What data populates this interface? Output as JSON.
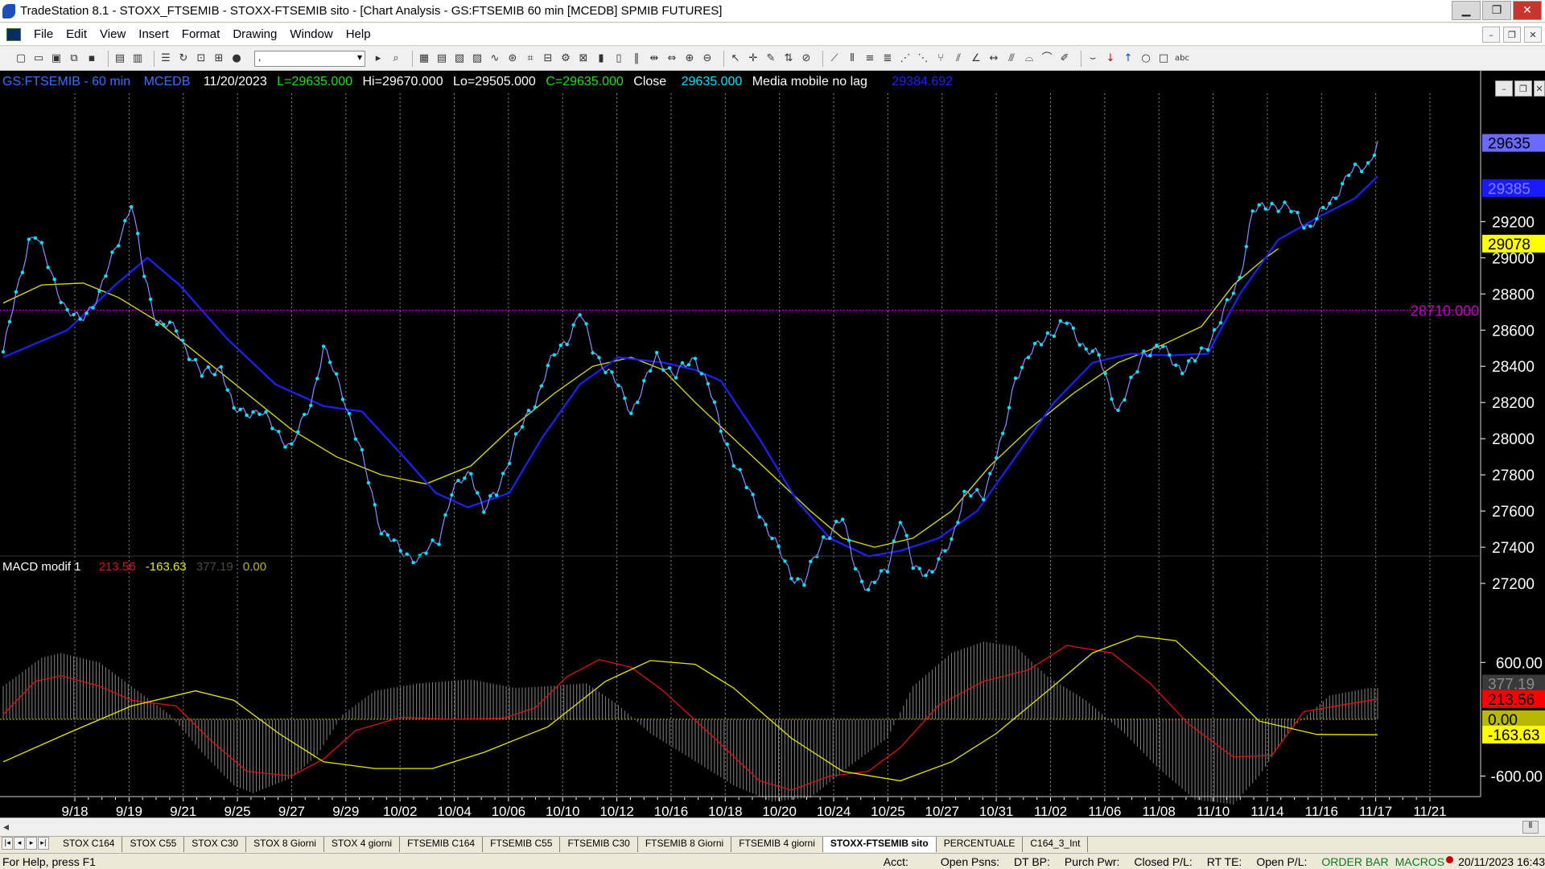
{
  "window": {
    "title": "TradeStation 8.1 - STOXX_FTSEMIB - STOXX-FTSEMIB sito - [Chart Analysis - GS:FTSEMIB  60 min  [MCEDB] SPMIB FUTURES]",
    "min_label": "▁",
    "max_label": "❐",
    "close_label": "✕"
  },
  "menu": {
    "items": [
      "File",
      "Edit",
      "View",
      "Insert",
      "Format",
      "Drawing",
      "Window",
      "Help"
    ],
    "mdi_min": "–",
    "mdi_restore": "❐",
    "mdi_close": "✕"
  },
  "toolbar": {
    "combo_value": ","
  },
  "header": {
    "symbol": "GS:FTSEMIB - 60 min",
    "exchange": "MCEDB",
    "date": "11/20/2023",
    "last": "L=29635.000",
    "high": "Hi=29670.000",
    "low": "Lo=29505.000",
    "close": "C=29635.000",
    "close_label": "Close",
    "close_value": "29635.000",
    "ma_label": "Media mobile no lag",
    "ma_value": "29384.692"
  },
  "macd_header": {
    "name": "MACD modif 1",
    "v1": "213.56",
    "v2": "-163.63",
    "v3": "377.19",
    "v4": "0.00"
  },
  "colors": {
    "price": "#00e5ff",
    "ma_blue": "#2020ff",
    "ma_yellow": "#e0e000",
    "macd_red": "#e01010",
    "macd_yellow": "#e8e800",
    "hist": "#7a7a7a",
    "hline": "#c000c0",
    "grid": "#8a8a8a"
  },
  "chart_data": [
    {
      "type": "line",
      "name": "price",
      "ylim": [
        27000,
        29900
      ],
      "yticks": [
        27200,
        27400,
        27600,
        27800,
        28000,
        28200,
        28400,
        28600,
        28800,
        29000,
        29200
      ],
      "xticks": [
        "9/18",
        "9/19",
        "9/21",
        "9/25",
        "9/27",
        "9/29",
        "10/02",
        "10/04",
        "10/06",
        "10/10",
        "10/12",
        "10/16",
        "10/18",
        "10/20",
        "10/24",
        "10/25",
        "10/27",
        "10/31",
        "11/02",
        "11/06",
        "11/08",
        "11/10",
        "11/14",
        "11/16",
        "11/17",
        "11/21"
      ],
      "bars_total": 430,
      "close": [
        [
          0,
          28480
        ],
        [
          8,
          29100
        ],
        [
          10,
          29130
        ],
        [
          20,
          28700
        ],
        [
          24,
          28650
        ],
        [
          30,
          28800
        ],
        [
          40,
          29300
        ],
        [
          44,
          28900
        ],
        [
          48,
          28650
        ],
        [
          54,
          28600
        ],
        [
          62,
          28350
        ],
        [
          68,
          28400
        ],
        [
          72,
          28150
        ],
        [
          80,
          28150
        ],
        [
          90,
          27950
        ],
        [
          96,
          28200
        ],
        [
          100,
          28500
        ],
        [
          106,
          28250
        ],
        [
          112,
          27900
        ],
        [
          118,
          27500
        ],
        [
          124,
          27380
        ],
        [
          130,
          27330
        ],
        [
          136,
          27450
        ],
        [
          140,
          27700
        ],
        [
          146,
          27820
        ],
        [
          150,
          27600
        ],
        [
          154,
          27700
        ],
        [
          160,
          28000
        ],
        [
          166,
          28200
        ],
        [
          170,
          28400
        ],
        [
          176,
          28550
        ],
        [
          180,
          28700
        ],
        [
          184,
          28490
        ],
        [
          190,
          28350
        ],
        [
          196,
          28150
        ],
        [
          204,
          28450
        ],
        [
          210,
          28350
        ],
        [
          216,
          28450
        ],
        [
          220,
          28300
        ],
        [
          224,
          28050
        ],
        [
          230,
          27800
        ],
        [
          236,
          27600
        ],
        [
          240,
          27450
        ],
        [
          246,
          27250
        ],
        [
          250,
          27200
        ],
        [
          256,
          27450
        ],
        [
          262,
          27550
        ],
        [
          266,
          27300
        ],
        [
          270,
          27150
        ],
        [
          276,
          27300
        ],
        [
          280,
          27550
        ],
        [
          284,
          27300
        ],
        [
          290,
          27250
        ],
        [
          296,
          27450
        ],
        [
          300,
          27680
        ],
        [
          306,
          27700
        ],
        [
          312,
          28000
        ],
        [
          316,
          28350
        ],
        [
          320,
          28450
        ],
        [
          326,
          28580
        ],
        [
          332,
          28640
        ],
        [
          338,
          28500
        ],
        [
          342,
          28450
        ],
        [
          348,
          28150
        ],
        [
          352,
          28300
        ],
        [
          356,
          28480
        ],
        [
          362,
          28500
        ],
        [
          368,
          28380
        ],
        [
          372,
          28430
        ],
        [
          376,
          28530
        ],
        [
          380,
          28650
        ],
        [
          386,
          28900
        ],
        [
          390,
          29250
        ],
        [
          396,
          29300
        ],
        [
          402,
          29260
        ],
        [
          408,
          29170
        ],
        [
          414,
          29300
        ],
        [
          420,
          29460
        ],
        [
          426,
          29520
        ],
        [
          429,
          29635
        ]
      ],
      "blue_ma": [
        [
          0,
          28450
        ],
        [
          20,
          28600
        ],
        [
          35,
          28850
        ],
        [
          45,
          29000
        ],
        [
          55,
          28850
        ],
        [
          70,
          28550
        ],
        [
          85,
          28300
        ],
        [
          100,
          28180
        ],
        [
          112,
          28150
        ],
        [
          125,
          27900
        ],
        [
          135,
          27700
        ],
        [
          145,
          27620
        ],
        [
          158,
          27700
        ],
        [
          168,
          28000
        ],
        [
          180,
          28300
        ],
        [
          192,
          28450
        ],
        [
          206,
          28420
        ],
        [
          216,
          28380
        ],
        [
          224,
          28320
        ],
        [
          236,
          28000
        ],
        [
          248,
          27650
        ],
        [
          258,
          27450
        ],
        [
          270,
          27350
        ],
        [
          280,
          27380
        ],
        [
          292,
          27450
        ],
        [
          304,
          27600
        ],
        [
          316,
          27900
        ],
        [
          328,
          28200
        ],
        [
          340,
          28420
        ],
        [
          352,
          28470
        ],
        [
          364,
          28460
        ],
        [
          376,
          28470
        ],
        [
          386,
          28800
        ],
        [
          398,
          29100
        ],
        [
          410,
          29220
        ],
        [
          422,
          29330
        ],
        [
          429,
          29450
        ]
      ],
      "yellow_ma": [
        [
          0,
          28750
        ],
        [
          12,
          28850
        ],
        [
          25,
          28860
        ],
        [
          36,
          28780
        ],
        [
          48,
          28650
        ],
        [
          62,
          28450
        ],
        [
          76,
          28250
        ],
        [
          90,
          28050
        ],
        [
          104,
          27900
        ],
        [
          118,
          27800
        ],
        [
          132,
          27750
        ],
        [
          146,
          27850
        ],
        [
          158,
          28050
        ],
        [
          172,
          28250
        ],
        [
          184,
          28400
        ],
        [
          196,
          28450
        ],
        [
          206,
          28380
        ],
        [
          216,
          28200
        ],
        [
          228,
          28000
        ],
        [
          240,
          27800
        ],
        [
          252,
          27600
        ],
        [
          262,
          27450
        ],
        [
          272,
          27400
        ],
        [
          284,
          27450
        ],
        [
          296,
          27600
        ],
        [
          308,
          27850
        ],
        [
          320,
          28050
        ],
        [
          334,
          28250
        ],
        [
          348,
          28420
        ],
        [
          362,
          28520
        ],
        [
          374,
          28620
        ],
        [
          384,
          28850
        ],
        [
          394,
          29000
        ],
        [
          398,
          29050
        ]
      ],
      "hline": 28710.0,
      "hline_label": "28710.000",
      "axis_tags": [
        {
          "value": 29635,
          "text": "29635",
          "bg": "#6a6aff",
          "fg": "#000000"
        },
        {
          "value": 29385,
          "text": "29385",
          "bg": "#1a1aff",
          "fg": "#8080ff"
        },
        {
          "value": 29078,
          "text": "29078",
          "bg": "#ffff00",
          "fg": "#000000"
        }
      ]
    },
    {
      "type": "area",
      "name": "macd",
      "ylim": [
        -800,
        900
      ],
      "yticks": [
        600,
        -600
      ],
      "ytick_labels": [
        "600.00",
        "-600.00"
      ],
      "hist": [
        [
          0,
          350
        ],
        [
          12,
          650
        ],
        [
          18,
          700
        ],
        [
          30,
          600
        ],
        [
          40,
          350
        ],
        [
          52,
          50
        ],
        [
          62,
          -350
        ],
        [
          72,
          -700
        ],
        [
          78,
          -780
        ],
        [
          90,
          -620
        ],
        [
          98,
          -380
        ],
        [
          106,
          50
        ],
        [
          116,
          300
        ],
        [
          130,
          380
        ],
        [
          146,
          420
        ],
        [
          160,
          330
        ],
        [
          170,
          350
        ],
        [
          182,
          380
        ],
        [
          192,
          150
        ],
        [
          202,
          -150
        ],
        [
          214,
          -400
        ],
        [
          228,
          -700
        ],
        [
          240,
          -870
        ],
        [
          252,
          -830
        ],
        [
          264,
          -500
        ],
        [
          276,
          -200
        ],
        [
          284,
          350
        ],
        [
          296,
          700
        ],
        [
          306,
          820
        ],
        [
          316,
          770
        ],
        [
          326,
          450
        ],
        [
          338,
          200
        ],
        [
          350,
          -150
        ],
        [
          360,
          -500
        ],
        [
          372,
          -850
        ],
        [
          384,
          -900
        ],
        [
          392,
          -600
        ],
        [
          402,
          -100
        ],
        [
          414,
          250
        ],
        [
          426,
          330
        ],
        [
          429,
          330
        ]
      ],
      "red": [
        [
          0,
          50
        ],
        [
          10,
          400
        ],
        [
          18,
          460
        ],
        [
          30,
          350
        ],
        [
          40,
          200
        ],
        [
          54,
          140
        ],
        [
          64,
          -200
        ],
        [
          76,
          -550
        ],
        [
          90,
          -600
        ],
        [
          100,
          -420
        ],
        [
          110,
          -120
        ],
        [
          124,
          20
        ],
        [
          140,
          0
        ],
        [
          156,
          10
        ],
        [
          166,
          120
        ],
        [
          176,
          450
        ],
        [
          186,
          630
        ],
        [
          196,
          550
        ],
        [
          206,
          300
        ],
        [
          222,
          -200
        ],
        [
          236,
          -650
        ],
        [
          246,
          -750
        ],
        [
          258,
          -600
        ],
        [
          270,
          -550
        ],
        [
          280,
          -300
        ],
        [
          292,
          150
        ],
        [
          306,
          400
        ],
        [
          320,
          520
        ],
        [
          332,
          780
        ],
        [
          346,
          700
        ],
        [
          358,
          380
        ],
        [
          370,
          -50
        ],
        [
          384,
          -400
        ],
        [
          396,
          -380
        ],
        [
          406,
          80
        ],
        [
          418,
          150
        ],
        [
          429,
          213
        ]
      ],
      "yellow": [
        [
          0,
          -450
        ],
        [
          20,
          -150
        ],
        [
          40,
          140
        ],
        [
          60,
          300
        ],
        [
          72,
          200
        ],
        [
          86,
          -150
        ],
        [
          100,
          -450
        ],
        [
          116,
          -520
        ],
        [
          134,
          -520
        ],
        [
          150,
          -350
        ],
        [
          170,
          -80
        ],
        [
          188,
          400
        ],
        [
          202,
          620
        ],
        [
          216,
          580
        ],
        [
          228,
          330
        ],
        [
          246,
          -200
        ],
        [
          262,
          -550
        ],
        [
          280,
          -650
        ],
        [
          296,
          -450
        ],
        [
          310,
          -150
        ],
        [
          326,
          300
        ],
        [
          340,
          700
        ],
        [
          354,
          880
        ],
        [
          366,
          830
        ],
        [
          378,
          450
        ],
        [
          392,
          -20
        ],
        [
          410,
          -160
        ],
        [
          429,
          -164
        ]
      ],
      "zero_line": 0,
      "axis_tags": [
        {
          "value": 377,
          "text": "377.19",
          "bg": "#3a3a3a",
          "fg": "#8a8a8a"
        },
        {
          "value": 213,
          "text": "213.56",
          "bg": "#ff0000",
          "fg": "#000000"
        },
        {
          "value": 0,
          "text": "0.00",
          "bg": "#b8b800",
          "fg": "#000000"
        },
        {
          "value": -163,
          "text": "-163.63",
          "bg": "#ffff00",
          "fg": "#000000"
        }
      ]
    }
  ],
  "tabs": [
    "STOX C164",
    "STOX C55",
    "STOX  C30",
    "STOX  8 Giorni",
    "STOX 4 giorni",
    "FTSEMIB C164",
    "FTSEMIB C55",
    "FTSEMIB C30",
    "FTSEMIB  8 Giorni",
    "FTSEMIB  4 giorni",
    "STOXX-FTSEMIB sito",
    "PERCENTUALE",
    "C164_3_Int"
  ],
  "active_tab": 10,
  "status": {
    "help": "For Help, press F1",
    "acct": "Acct:",
    "open_psns": "Open Psns:",
    "dt_bp": "DT BP:",
    "purch_pwr": "Purch Pwr:",
    "closed_pl": "Closed P/L:",
    "rt_te": "RT TE:",
    "open_pl": "Open P/L:",
    "order_bar": "ORDER BAR",
    "macros": "MACROS",
    "datetime": "20/11/2023 16:43"
  }
}
